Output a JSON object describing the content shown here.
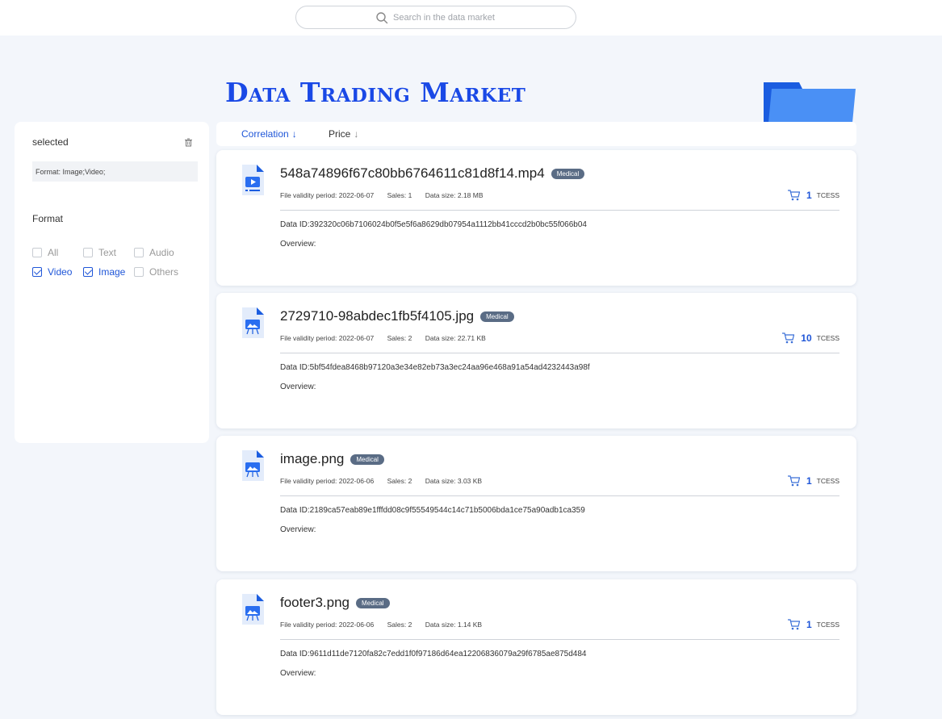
{
  "search": {
    "placeholder": "Search in the data market"
  },
  "hero": {
    "title": "Data Trading Market"
  },
  "sidebar": {
    "selected_label": "selected",
    "selected_value": "Format: Image;Video;",
    "format_label": "Format",
    "options": [
      {
        "label": "All",
        "checked": false
      },
      {
        "label": "Text",
        "checked": false
      },
      {
        "label": "Audio",
        "checked": false
      },
      {
        "label": "Video",
        "checked": true
      },
      {
        "label": "Image",
        "checked": true
      },
      {
        "label": "Others",
        "checked": false
      }
    ]
  },
  "sort": {
    "correlation": "Correlation",
    "price": "Price",
    "arrow": "↓"
  },
  "colors": {
    "accent": "#1f56d8",
    "title": "#1a49e6",
    "tag": "#5a6c85"
  },
  "items": [
    {
      "icon": "video-file-icon",
      "name": "548a74896f67c80bb6764611c81d8f14.mp4",
      "tag": "Medical",
      "validity": "File validity period: 2022-06-07",
      "sales": "Sales: 1",
      "size": "Data size: 2.18 MB",
      "price": "1",
      "currency": "TCESS",
      "data_id": "Data ID:392320c06b7106024b0f5e5f6a8629db07954a1112bb41cccd2b0bc55f066b04",
      "overview": "Overview:"
    },
    {
      "icon": "image-file-icon",
      "name": "2729710-98abdec1fb5f4105.jpg",
      "tag": "Medical",
      "validity": "File validity period: 2022-06-07",
      "sales": "Sales: 2",
      "size": "Data size: 22.71 KB",
      "price": "10",
      "currency": "TCESS",
      "data_id": "Data ID:5bf54fdea8468b97120a3e34e82eb73a3ec24aa96e468a91a54ad4232443a98f",
      "overview": "Overview:"
    },
    {
      "icon": "image-file-icon",
      "name": "image.png",
      "tag": "Medical",
      "validity": "File validity period: 2022-06-06",
      "sales": "Sales: 2",
      "size": "Data size: 3.03 KB",
      "price": "1",
      "currency": "TCESS",
      "data_id": "Data ID:2189ca57eab89e1fffdd08c9f55549544c14c71b5006bda1ce75a90adb1ca359",
      "overview": "Overview:"
    },
    {
      "icon": "image-file-icon",
      "name": "footer3.png",
      "tag": "Medical",
      "validity": "File validity period: 2022-06-06",
      "sales": "Sales: 2",
      "size": "Data size: 1.14 KB",
      "price": "1",
      "currency": "TCESS",
      "data_id": "Data ID:9611d11de7120fa82c7edd1f0f97186d64ea12206836079a29f6785ae875d484",
      "overview": "Overview:"
    }
  ]
}
